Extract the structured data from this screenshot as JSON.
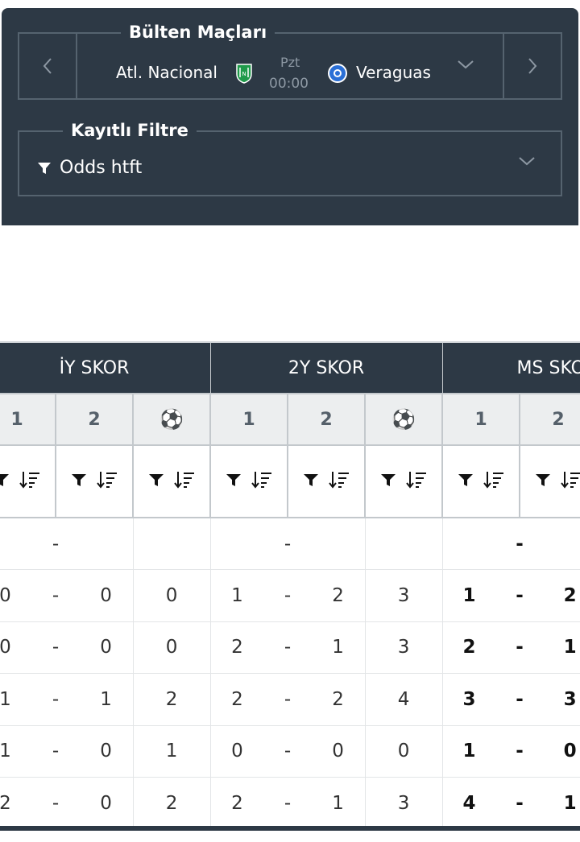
{
  "bulletin": {
    "title": "Bülten Maçları",
    "home_team": "Atl. Nacional",
    "away_team": "Veraguas",
    "day": "Pzt",
    "time": "00:00"
  },
  "saved_filter": {
    "title": "Kayıtlı Filtre",
    "selected": "Odds htft"
  },
  "table": {
    "groups": [
      "İY SKOR",
      "2Y SKOR",
      "MS SKOR"
    ],
    "sub_headers": [
      "1",
      "2",
      "⚽",
      "1",
      "2",
      "⚽",
      "1",
      "2",
      "⚽"
    ],
    "rows": [
      {
        "iy": [
          "",
          "",
          ""
        ],
        "iy_goals": "",
        "sy": [
          "",
          "",
          ""
        ],
        "sy_goals": "",
        "ms": [
          "",
          "",
          ""
        ]
      },
      {
        "iy": [
          "0",
          "-",
          "0"
        ],
        "iy_goals": "0",
        "sy": [
          "1",
          "-",
          "2"
        ],
        "sy_goals": "3",
        "ms": [
          "1",
          "-",
          "2"
        ]
      },
      {
        "iy": [
          "0",
          "-",
          "0"
        ],
        "iy_goals": "0",
        "sy": [
          "2",
          "-",
          "1"
        ],
        "sy_goals": "3",
        "ms": [
          "2",
          "-",
          "1"
        ]
      },
      {
        "iy": [
          "1",
          "-",
          "1"
        ],
        "iy_goals": "2",
        "sy": [
          "2",
          "-",
          "2"
        ],
        "sy_goals": "4",
        "ms": [
          "3",
          "-",
          "3"
        ]
      },
      {
        "iy": [
          "1",
          "-",
          "0"
        ],
        "iy_goals": "1",
        "sy": [
          "0",
          "-",
          "0"
        ],
        "sy_goals": "0",
        "ms": [
          "1",
          "-",
          "0"
        ]
      },
      {
        "iy": [
          "2",
          "-",
          "0"
        ],
        "iy_goals": "2",
        "sy": [
          "2",
          "-",
          "1"
        ],
        "sy_goals": "3",
        "ms": [
          "4",
          "-",
          "1"
        ]
      }
    ],
    "empty_row_dash": "-"
  },
  "colors": {
    "panel_bg": "#2d3945",
    "border": "#55636f",
    "subheader_bg": "#eceeef"
  }
}
